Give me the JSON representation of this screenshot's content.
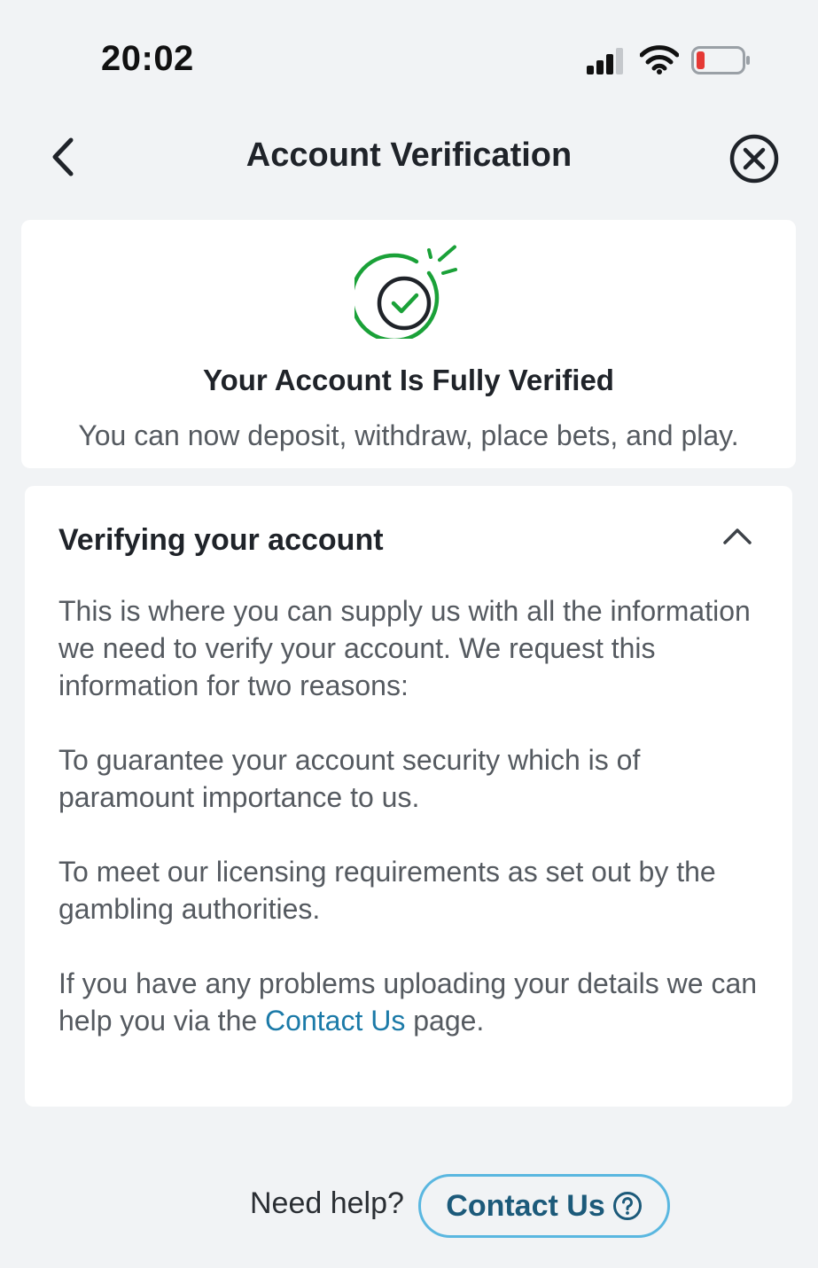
{
  "status_bar": {
    "time": "20:02",
    "icons": [
      "signal-icon",
      "wifi-icon",
      "battery-low-icon"
    ],
    "battery_color": "#e53935"
  },
  "header": {
    "title": "Account Verification",
    "back_icon": "chevron-left-icon",
    "close_icon": "close-circle-icon"
  },
  "verified_card": {
    "icon": "verified-check-icon",
    "title": "Your Account Is Fully Verified",
    "subtitle": "You can now deposit, withdraw, place bets, and play.",
    "accent_color": "#1aa138"
  },
  "info_card": {
    "heading": "Verifying your account",
    "toggle_icon": "chevron-up-icon",
    "paragraphs": [
      "This is where you can supply us with all the information we need to verify your account. We request this information for two reasons:",
      "To guarantee your account security which is of paramount importance to us.",
      "To meet our licensing requirements as set out by the gambling authorities."
    ],
    "last_paragraph": {
      "before_link": "If you have any problems uploading your details we can help you via the ",
      "link_text": "Contact Us",
      "after_link": " page."
    },
    "link_color": "#1b7aa8"
  },
  "footer": {
    "help_label": "Need help?",
    "contact_button_label": "Contact Us",
    "contact_button_icon": "question-circle-icon",
    "button_border_color": "#5ab7e0"
  }
}
